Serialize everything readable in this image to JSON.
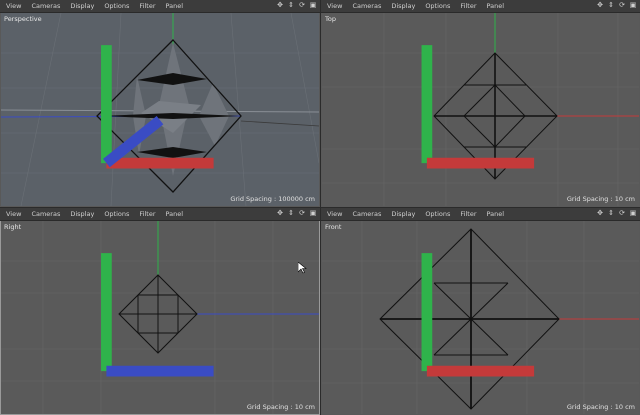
{
  "menu": [
    "View",
    "Cameras",
    "Display",
    "Options",
    "Filter",
    "Panel"
  ],
  "tool_icons": [
    "move-icon",
    "zoom-icon",
    "rotate-icon",
    "maximize-icon"
  ],
  "viewports": {
    "perspective": {
      "label": "Perspective",
      "grid_spacing": "Grid Spacing : 100000 cm",
      "bg": "#5b6168"
    },
    "top": {
      "label": "Top",
      "grid_spacing": "Grid Spacing : 10 cm",
      "bg": "#5a5a5a"
    },
    "right": {
      "label": "Right",
      "grid_spacing": "Grid Spacing : 10 cm",
      "bg": "#5a5a5a"
    },
    "front": {
      "label": "Front",
      "grid_spacing": "Grid Spacing : 10 cm",
      "bg": "#5a5a5a"
    }
  },
  "colors": {
    "x_axis": "#c43a3a",
    "y_axis": "#2fb34b",
    "z_axis": "#3a4cc4",
    "wire": "#111111"
  }
}
